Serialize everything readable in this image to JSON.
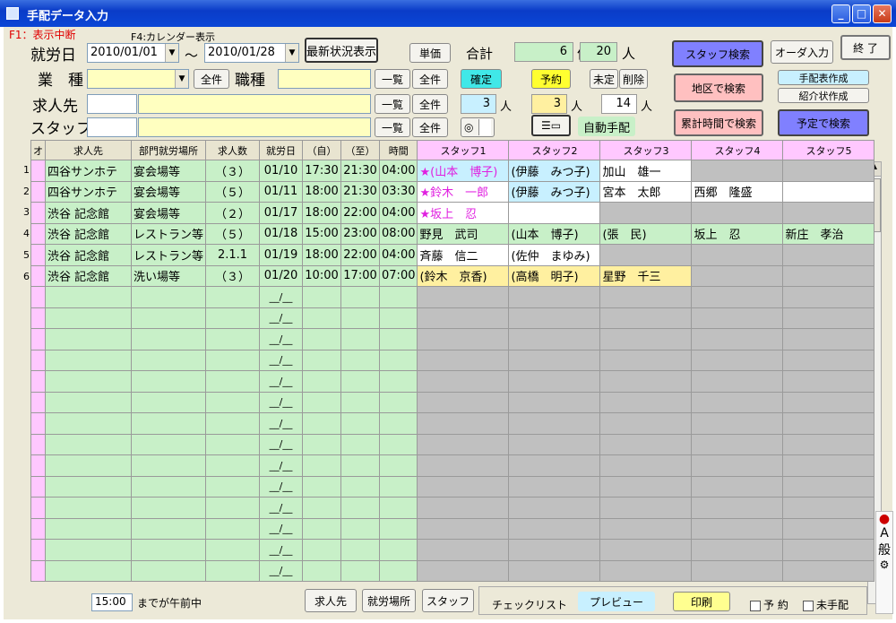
{
  "window": {
    "title": "手配データ入力"
  },
  "hints": {
    "f1": "F1：表示中断",
    "f4": "F4:カレンダー表示"
  },
  "filters": {
    "shuro_label": "就労日",
    "date_from": "2010/01/01",
    "tilde": "～",
    "date_to": "2010/01/28",
    "gyoshu_label": "業　種",
    "shokushu_label": "職種",
    "kyujin_label": "求人先",
    "staff_label": "スタッフ"
  },
  "buttons": {
    "latest": "最新状況表示",
    "tanka": "単価",
    "all": "全件",
    "ichiran": "一覧",
    "kakutei": "確定",
    "yoyaku": "予約",
    "mitei": "未定",
    "sakujo": "削除",
    "auto": "自動手配",
    "staff_search": "スタッフ検索",
    "order_input": "オーダ入力",
    "exit": "終 了",
    "area_search": "地区で検索",
    "tehai_create": "手配表作成",
    "shokai_create": "紹介状作成",
    "cum_search": "累計時間で検索",
    "plan_search": "予定で検索",
    "kyujin": "求人先",
    "shuro_basho": "就労場所",
    "staff": "スタッフ",
    "checklist": "チェックリスト",
    "preview": "プレビュー",
    "print": "印刷",
    "yoyaku_chk": "予 約",
    "mitehai_chk": "未手配",
    "toggle": "◎"
  },
  "totals": {
    "label": "合計",
    "count": "6",
    "count_unit": "件",
    "people": "20",
    "people_unit": "人",
    "confirmed": "3",
    "reserved": "3",
    "undecided": "14",
    "unit": "人"
  },
  "grid": {
    "headers": [
      "オ",
      "求人先",
      "部門就労場所",
      "求人数",
      "就労日",
      "（自）",
      "（至）",
      "時間",
      "スタッフ1",
      "スタッフ2",
      "スタッフ3",
      "スタッフ4",
      "スタッフ5"
    ],
    "rows": [
      {
        "no": "1",
        "client": "四谷サンホテ",
        "place": "宴会場等",
        "num": "（３）",
        "date": "01/10",
        "from": "17:30",
        "to": "21:30",
        "hours": "04:00",
        "s1": "★(山本　博子)",
        "s2": "(伊藤　みつ子)",
        "s3": "加山　雄一",
        "s4": "",
        "s5": ""
      },
      {
        "no": "2",
        "client": "四谷サンホテ",
        "place": "宴会場等",
        "num": "（５）",
        "date": "01/11",
        "from": "18:00",
        "to": "21:30",
        "hours": "03:30",
        "s1": "★鈴木　一郎",
        "s2": "(伊藤　みつ子)",
        "s3": "宮本　太郎",
        "s4": "西郷　隆盛",
        "s5": ""
      },
      {
        "no": "3",
        "client": "渋谷 記念館",
        "place": "宴会場等",
        "num": "（２）",
        "date": "01/17",
        "from": "18:00",
        "to": "22:00",
        "hours": "04:00",
        "s1": "★坂上　忍",
        "s2": "",
        "s3": "",
        "s4": "",
        "s5": ""
      },
      {
        "no": "4",
        "client": "渋谷 記念館",
        "place": "レストラン等",
        "num": "（５）",
        "date": "01/18",
        "from": "15:00",
        "to": "23:00",
        "hours": "08:00",
        "s1": "野見　武司",
        "s2": "(山本　博子)",
        "s3": "(張　民)",
        "s4": "坂上　忍",
        "s5": "新庄　孝治"
      },
      {
        "no": "5",
        "client": "渋谷 記念館",
        "place": "レストラン等",
        "num": "2.1.1",
        "date": "01/19",
        "from": "18:00",
        "to": "22:00",
        "hours": "04:00",
        "s1": "斉藤　信二",
        "s2": "(佐仲　まゆみ)",
        "s3": "",
        "s4": "",
        "s5": ""
      },
      {
        "no": "6",
        "client": "渋谷 記念館",
        "place": "洗い場等",
        "num": "（３）",
        "date": "01/20",
        "from": "10:00",
        "to": "17:00",
        "hours": "07:00",
        "s1": "(鈴木　京香)",
        "s2": "(高橋　明子)",
        "s3": "星野　千三",
        "s4": "",
        "s5": ""
      }
    ],
    "empty_date": "__/__"
  },
  "footer": {
    "time": "15:00",
    "time_suffix": "までが午前中"
  },
  "side": {
    "a": "A",
    "ippan": "般"
  },
  "colors": {
    "green": "#c8f0c8",
    "gray": "#c0c0c0",
    "pink": "#ffc8ff",
    "magenta": "#e020e0",
    "lightblue": "#c8f0ff",
    "yellow": "#fff0a0",
    "purple": "#8080ff",
    "salmon": "#ffc0c0"
  }
}
